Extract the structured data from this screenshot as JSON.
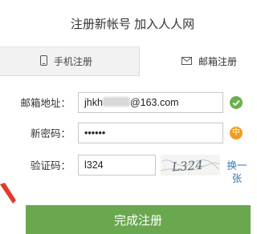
{
  "page": {
    "title": "注册新帐号 加入人人网"
  },
  "tabs": [
    {
      "label": "手机注册",
      "icon": "phone-icon",
      "active": false
    },
    {
      "label": "邮箱注册",
      "icon": "mail-icon",
      "active": true
    }
  ],
  "form": {
    "email": {
      "label": "邮箱地址：",
      "value_prefix": "jhkh",
      "value_suffix": "@163.com",
      "status_icon": "check-icon"
    },
    "password": {
      "label": "新密码：",
      "value": "••••••",
      "strength": "中"
    },
    "captcha": {
      "label": "验证码：",
      "value": "l324",
      "image_text": "L324",
      "refresh_label": "换一张"
    }
  },
  "submit": {
    "label": "完成注册"
  },
  "colors": {
    "accent": "#6aa84f",
    "link": "#2f7ab9",
    "ok": "#6ab04c",
    "strength_mid": "#f39c1f",
    "arrow": "#e03a2e"
  }
}
